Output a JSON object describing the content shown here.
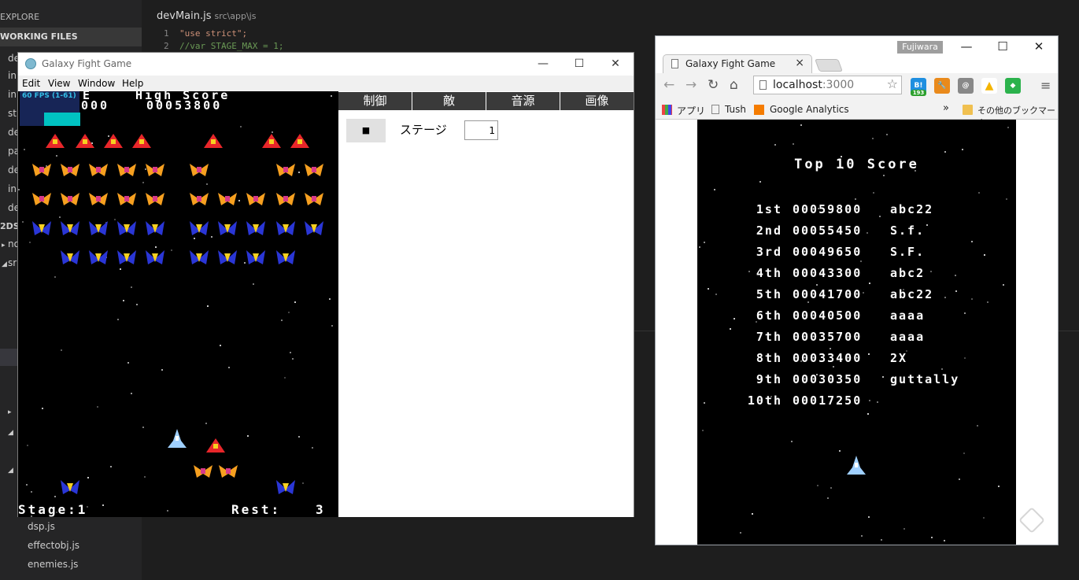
{
  "editor": {
    "sidebar": {
      "explore_label": "EXPLORE",
      "working_files_label": "WORKING FILES",
      "truncated_items": [
        "de",
        "in",
        "in",
        "st",
        "de",
        "pa",
        "de",
        "in",
        "de"
      ],
      "section_2dsh": "2DSH",
      "tree_items": [
        "no",
        "sr"
      ],
      "files": [
        "dsp.js",
        "effectobj.js",
        "enemies.js"
      ]
    },
    "tab": {
      "filename": "devMain.js",
      "path": "src\\app\\js"
    },
    "code_lines": [
      {
        "num": "1",
        "text": "\"use strict\";",
        "kind": "str"
      },
      {
        "num": "2",
        "text": "//var STAGE_MAX = 1;",
        "kind": "cmt"
      }
    ]
  },
  "game_window": {
    "title": "Galaxy Fight Game",
    "menu": [
      "Edit",
      "View",
      "Window",
      "Help"
    ],
    "controls": {
      "minimize": "—",
      "maximize": "☐",
      "close": "✕"
    },
    "hud": {
      "fps": "60 FPS (1-61)",
      "score_partial": "000",
      "score_label_partial": "E",
      "high_score_label": "High Score",
      "high_score_value": "00053800",
      "stage_text": "Stage:1",
      "rest_label": "Rest:",
      "rest_value": "3"
    },
    "panel": {
      "tabs": [
        "制御",
        "敵",
        "音源",
        "画像"
      ],
      "stop_button": "■",
      "stage_label": "ステージ",
      "stage_value": "1"
    }
  },
  "browser": {
    "tab_title": "Galaxy Fight Game",
    "user_badge": "Fujiwara",
    "controls": {
      "minimize": "—",
      "maximize": "☐",
      "close": "✕"
    },
    "url_host": "localhost",
    "url_port": ":3000",
    "extensions": [
      {
        "name": "hatena-bookmark",
        "label": "B!",
        "sub": "193",
        "color": "#1f8fe0"
      },
      {
        "name": "tools",
        "label": "🔧",
        "color": "#e98a1c"
      },
      {
        "name": "mail-checker",
        "label": "@",
        "color": "#888888"
      },
      {
        "name": "google-drive",
        "label": "▲",
        "color": "#ffffff"
      },
      {
        "name": "feedly",
        "label": "◆",
        "color": "#2bb24c"
      }
    ],
    "bookmarks": {
      "apps": "アプリ",
      "tush": "Tush",
      "analytics": "Google Analytics",
      "more": "»",
      "other": "その他のブックマーク"
    },
    "highscores": {
      "title": "Top 10 Score",
      "rows": [
        {
          "rank": "1st",
          "score": "00059800",
          "name": "abc22"
        },
        {
          "rank": "2nd",
          "score": "00055450",
          "name": "S.f."
        },
        {
          "rank": "3rd",
          "score": "00049650",
          "name": "S.F."
        },
        {
          "rank": "4th",
          "score": "00043300",
          "name": "abc2"
        },
        {
          "rank": "5th",
          "score": "00041700",
          "name": "abc22"
        },
        {
          "rank": "6th",
          "score": "00040500",
          "name": "aaaa"
        },
        {
          "rank": "7th",
          "score": "00035700",
          "name": "aaaa"
        },
        {
          "rank": "8th",
          "score": "00033400",
          "name": "2X"
        },
        {
          "rank": "9th",
          "score": "00030350",
          "name": "guttally"
        },
        {
          "rank": "10th",
          "score": "00017250",
          "name": ""
        }
      ]
    }
  },
  "colors": {
    "panel_tab_bg": "#3a3a3a",
    "fps_bar": "#00d8d8",
    "enemy_red": "#e8262a",
    "enemy_orange": "#f7a020",
    "enemy_blue": "#2a36d6",
    "player_ship": "#9fd0ff"
  }
}
